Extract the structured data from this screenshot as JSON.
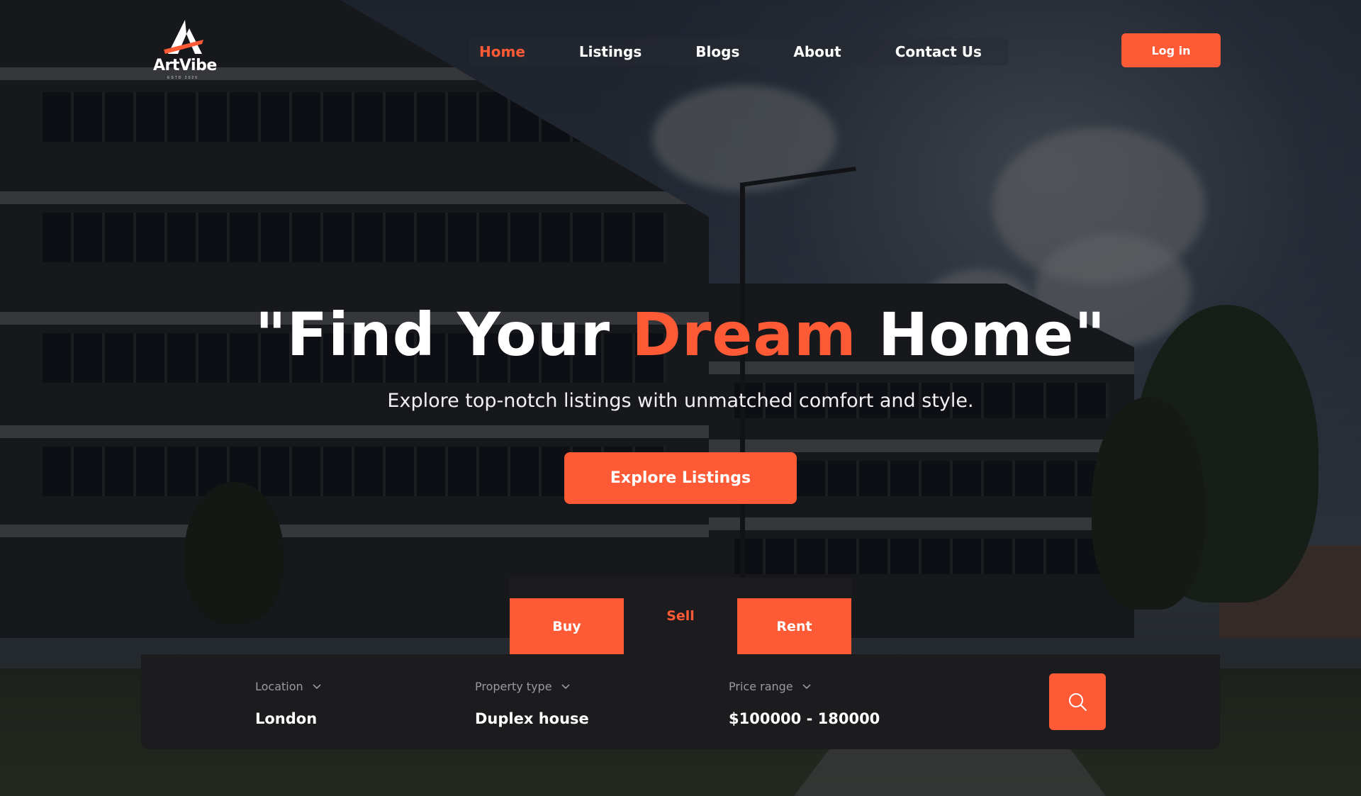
{
  "brand": {
    "name": "ArtVibe",
    "tagline": "ESTD 2020"
  },
  "nav": {
    "items": [
      {
        "label": "Home",
        "active": true
      },
      {
        "label": "Listings",
        "active": false
      },
      {
        "label": "Blogs",
        "active": false
      },
      {
        "label": "About",
        "active": false
      },
      {
        "label": "Contact Us",
        "active": false
      }
    ],
    "login_label": "Log in"
  },
  "hero": {
    "headline_before": "\"Find Your ",
    "headline_accent": "Dream",
    "headline_after": " Home\"",
    "subline": "Explore top-notch listings with unmatched comfort and style.",
    "cta_label": "Explore Listings"
  },
  "tabs": [
    {
      "label": "Buy",
      "selected": false
    },
    {
      "label": "Sell",
      "selected": true
    },
    {
      "label": "Rent",
      "selected": false
    }
  ],
  "search": {
    "fields": [
      {
        "label": "Location",
        "value": "London"
      },
      {
        "label": "Property type",
        "value": "Duplex house"
      },
      {
        "label": "Price range",
        "value": "$100000 - 180000"
      }
    ],
    "button_icon": "search-icon"
  },
  "colors": {
    "accent": "#ff5a36",
    "panel": "#1c1c1f",
    "muted_text": "#9a9a9c"
  }
}
